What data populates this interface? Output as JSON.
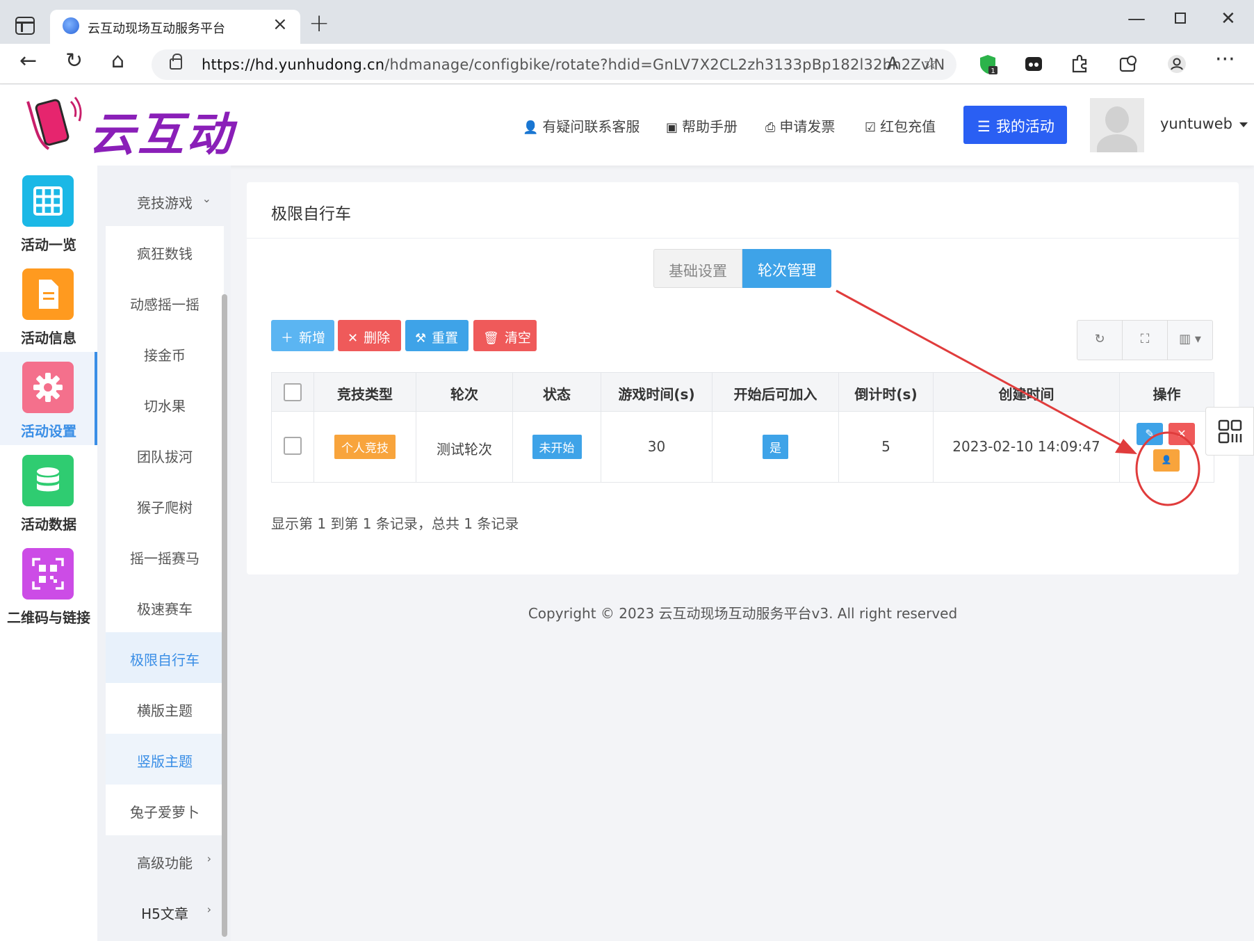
{
  "browser": {
    "tab_title": "云互动现场互动服务平台",
    "url_host": "https://hd.yunhudong.cn",
    "url_path": "/hdmanage/configbike/rotate?hdid=GnLV7X2CL2zh3133pBp182l32bh2ZvlN",
    "extension_badge": "1"
  },
  "header": {
    "logo_text": "云互动",
    "links": [
      {
        "icon": "user-plus-icon",
        "label": "有疑问联系客服"
      },
      {
        "icon": "book-icon",
        "label": "帮助手册"
      },
      {
        "icon": "printer-icon",
        "label": "申请发票"
      },
      {
        "icon": "check-square-icon",
        "label": "红包充值"
      }
    ],
    "my_activity": "我的活动",
    "username": "yuntuweb"
  },
  "left_rail": [
    {
      "label": "活动一览",
      "color": "#1bb8e6",
      "icon": "grid-icon"
    },
    {
      "label": "活动信息",
      "color": "#ff9a1f",
      "icon": "document-icon"
    },
    {
      "label": "活动设置",
      "color": "#f4708c",
      "icon": "gear-icon",
      "active": true
    },
    {
      "label": "活动数据",
      "color": "#2fcc71",
      "icon": "database-icon"
    },
    {
      "label": "二维码与链接",
      "color": "#cc4ce6",
      "icon": "qrcode-icon"
    }
  ],
  "sub_menu": [
    {
      "label": "竞技游戏",
      "arrow": "⌄"
    },
    {
      "label": "疯狂数钱"
    },
    {
      "label": "动感摇一摇"
    },
    {
      "label": "接金币"
    },
    {
      "label": "切水果"
    },
    {
      "label": "团队拔河"
    },
    {
      "label": "猴子爬树"
    },
    {
      "label": "摇一摇赛马"
    },
    {
      "label": "极速赛车"
    },
    {
      "label": "极限自行车"
    },
    {
      "label": "横版主题"
    },
    {
      "label": "竖版主题"
    },
    {
      "label": "兔子爱萝卜"
    },
    {
      "label": "高级功能",
      "arrow": "›"
    },
    {
      "label": "H5文章",
      "arrow": "›"
    }
  ],
  "main": {
    "title": "极限自行车",
    "segments": [
      "基础设置",
      "轮次管理"
    ],
    "toolbar": {
      "add": "新增",
      "delete": "删除",
      "reset": "重置",
      "clear": "清空"
    },
    "table": {
      "headers": [
        "竞技类型",
        "轮次",
        "状态",
        "游戏时间(s)",
        "开始后可加入",
        "倒计时(s)",
        "创建时间",
        "操作"
      ],
      "rows": [
        {
          "type": "个人竞技",
          "round": "测试轮次",
          "status": "未开始",
          "game_time": "30",
          "join_after_start": "是",
          "countdown": "5",
          "created": "2023-02-10 14:09:47"
        }
      ]
    },
    "pager_text": "显示第 1 到第 1 条记录，总共 1 条记录"
  },
  "footer": {
    "copyright": "Copyright © 2023 云互动现场互动服务平台v3. All right reserved"
  }
}
